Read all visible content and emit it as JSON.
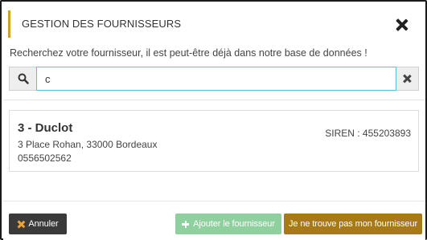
{
  "modal": {
    "title": "GESTION DES FOURNISSEURS",
    "accent_color": "#c9a227"
  },
  "search": {
    "hint": "Recherchez votre fournisseur, il est peut-être déjà dans notre base de données !",
    "value": "c",
    "placeholder": "",
    "focus_color": "#5bc0de"
  },
  "results": [
    {
      "name": "3 - Duclot",
      "address": "3 Place Rohan, 33000 Bordeaux",
      "phone": "0556502562",
      "siren": "SIREN : 455203893"
    }
  ],
  "footer": {
    "cancel_label": "Annuler",
    "add_label": "Ajouter le fournisseur",
    "not_found_label": "Je ne trouve pas mon fournisseur",
    "cancel_color": "#3a3a3a",
    "add_color": "#8fd19e",
    "not_found_color": "#a77a17"
  },
  "icons": {
    "close": "close-icon",
    "search": "search-icon",
    "clear": "clear-icon",
    "cancel": "times-icon",
    "add": "plus-icon"
  }
}
